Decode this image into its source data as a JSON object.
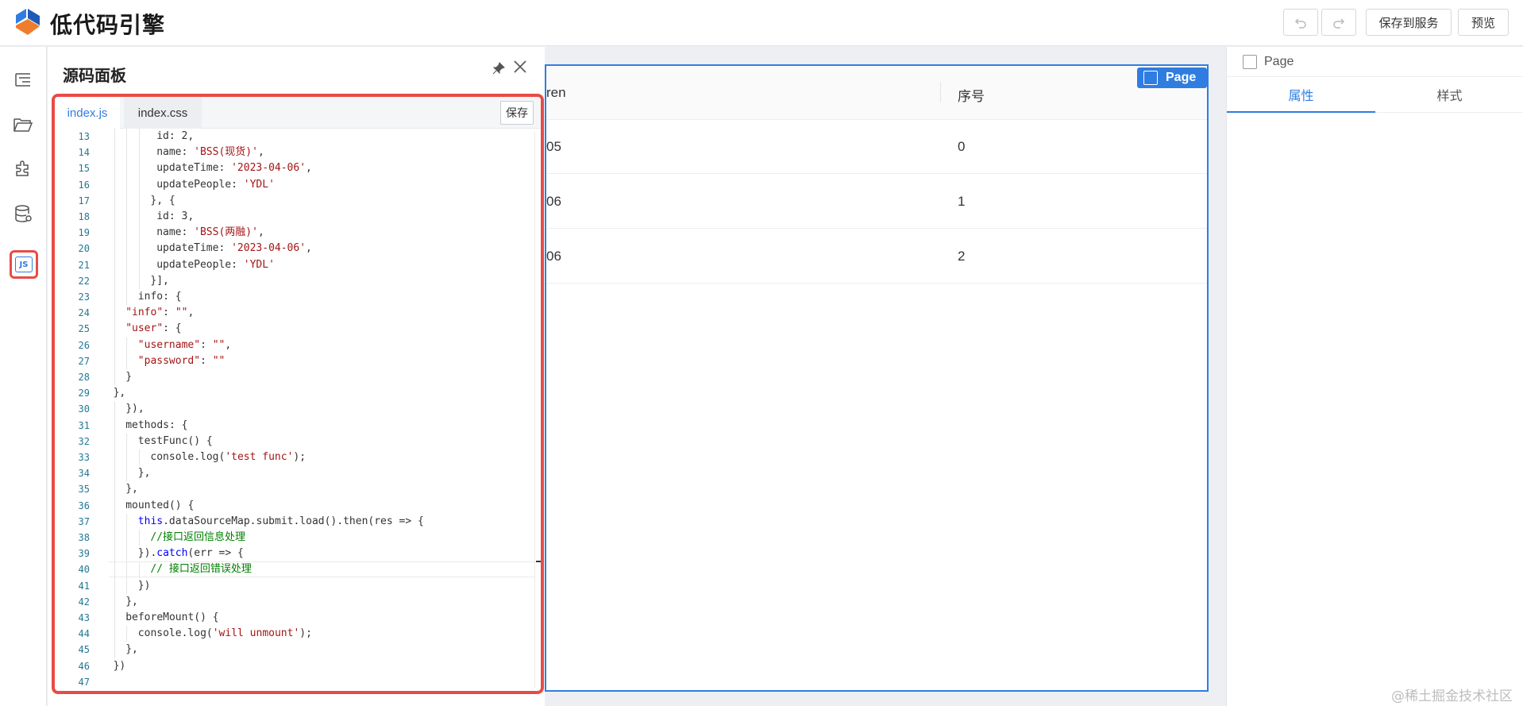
{
  "app": {
    "title": "低代码引擎"
  },
  "toolbar": {
    "undo_icon": "undo-icon",
    "redo_icon": "redo-icon",
    "save_service_label": "保存到服务",
    "preview_label": "预览"
  },
  "rail": {
    "icons": [
      "outline-tree-icon",
      "folder-icon",
      "puzzle-icon",
      "database-icon",
      "js-code-icon",
      "more-icon"
    ],
    "js_label": "JS",
    "more_label": "•••"
  },
  "source_panel": {
    "title": "源码面板",
    "tabs": [
      {
        "label": "index.js",
        "active": true
      },
      {
        "label": "index.css",
        "active": false
      }
    ],
    "save_label": "保存",
    "code_lines": [
      {
        "n": "13",
        "indent": 7,
        "text": "id: 2,"
      },
      {
        "n": "14",
        "indent": 7,
        "text": "name: 'BSS(现货)',"
      },
      {
        "n": "15",
        "indent": 7,
        "text": "updateTime: '2023-04-06',"
      },
      {
        "n": "16",
        "indent": 7,
        "text": "updatePeople: 'YDL'"
      },
      {
        "n": "17",
        "indent": 6,
        "text": "}, {"
      },
      {
        "n": "18",
        "indent": 7,
        "text": "id: 3,"
      },
      {
        "n": "19",
        "indent": 7,
        "text": "name: 'BSS(两融)',"
      },
      {
        "n": "20",
        "indent": 7,
        "text": "updateTime: '2023-04-06',"
      },
      {
        "n": "21",
        "indent": 7,
        "text": "updatePeople: 'YDL'"
      },
      {
        "n": "22",
        "indent": 6,
        "text": "}],"
      },
      {
        "n": "23",
        "indent": 4,
        "text": "info: {"
      },
      {
        "n": "24",
        "indent": 2,
        "text": "\"info\": \"\","
      },
      {
        "n": "25",
        "indent": 2,
        "text": "\"user\": {"
      },
      {
        "n": "26",
        "indent": 4,
        "text": "\"username\": \"\","
      },
      {
        "n": "27",
        "indent": 4,
        "text": "\"password\": \"\""
      },
      {
        "n": "28",
        "indent": 2,
        "text": "}"
      },
      {
        "n": "29",
        "indent": 0,
        "text": "},"
      },
      {
        "n": "30",
        "indent": 2,
        "text": "}),"
      },
      {
        "n": "31",
        "indent": 2,
        "text": "methods: {"
      },
      {
        "n": "32",
        "indent": 4,
        "text": "testFunc() {"
      },
      {
        "n": "33",
        "indent": 6,
        "text": "console.log('test func');"
      },
      {
        "n": "34",
        "indent": 4,
        "text": "},"
      },
      {
        "n": "35",
        "indent": 2,
        "text": "},"
      },
      {
        "n": "36",
        "indent": 2,
        "text": "mounted() {"
      },
      {
        "n": "37",
        "indent": 4,
        "text": "this.dataSourceMap.submit.load().then(res => {"
      },
      {
        "n": "38",
        "indent": 6,
        "text": "//接口返回信息处理"
      },
      {
        "n": "39",
        "indent": 4,
        "text": "}).catch(err => {"
      },
      {
        "n": "40",
        "indent": 6,
        "text": "// 接口返回错误处理"
      },
      {
        "n": "41",
        "indent": 4,
        "text": "})"
      },
      {
        "n": "42",
        "indent": 2,
        "text": "},"
      },
      {
        "n": "43",
        "indent": 2,
        "text": "beforeMount() {"
      },
      {
        "n": "44",
        "indent": 4,
        "text": "console.log('will unmount');"
      },
      {
        "n": "45",
        "indent": 2,
        "text": "},"
      },
      {
        "n": "46",
        "indent": 0,
        "text": "})"
      },
      {
        "n": "47",
        "indent": 0,
        "text": ""
      }
    ]
  },
  "canvas": {
    "page_tag": "Page",
    "table": {
      "headers": [
        "ren",
        "序号"
      ],
      "rows": [
        [
          "05",
          "0"
        ],
        [
          "06",
          "1"
        ],
        [
          "06",
          "2"
        ]
      ]
    }
  },
  "settings_panel": {
    "breadcrumb": "Page",
    "tabs": [
      {
        "label": "属性",
        "active": true
      },
      {
        "label": "样式",
        "active": false
      }
    ]
  },
  "watermark": "@稀土掘金技术社区",
  "colors": {
    "accent": "#2f7de1",
    "highlight_border": "#e74c46",
    "string": "#a31515",
    "comment": "#008000",
    "keyword": "#0000ff"
  }
}
